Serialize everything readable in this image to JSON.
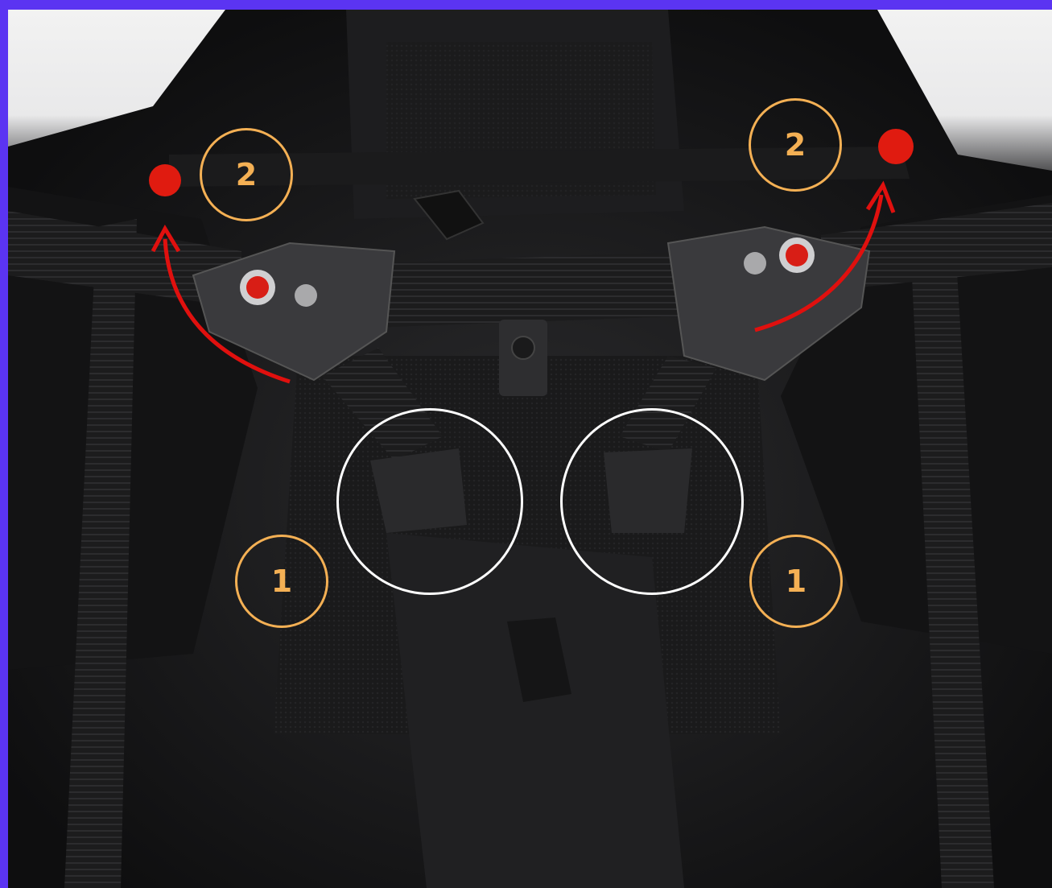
{
  "image": {
    "frame_color": "#5b34f2",
    "annotation_color": "#f4b054",
    "arrow_color": "#e0100e",
    "ring_color": "#ffffff",
    "subject": "paragliding-harness-chest-strap-buckles"
  },
  "annotations": {
    "step1_left": "1",
    "step1_right": "1",
    "step2_left": "2",
    "step2_right": "2"
  }
}
